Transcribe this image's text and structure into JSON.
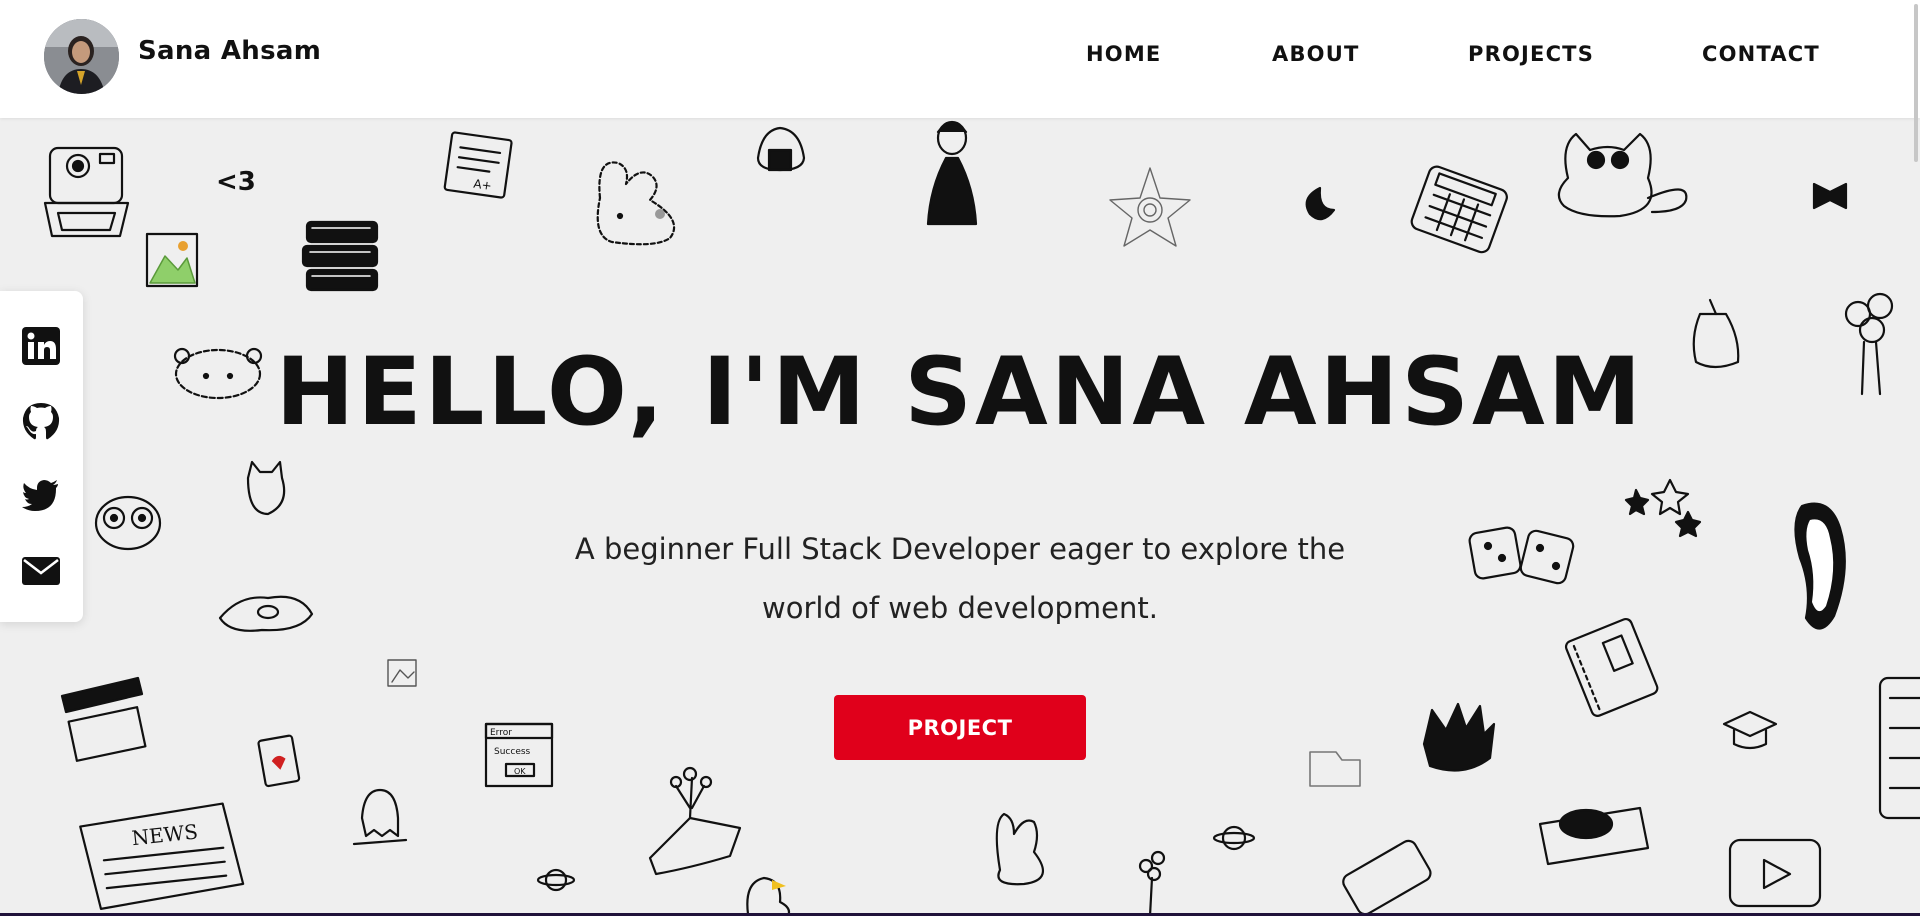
{
  "header": {
    "brand_name": "Sana Ahsam",
    "avatar_alt": "profile photo",
    "nav": [
      {
        "label": "HOME"
      },
      {
        "label": "ABOUT"
      },
      {
        "label": "PROJECTS"
      },
      {
        "label": "CONTACT"
      }
    ]
  },
  "hero": {
    "headline": "HELLO, I'M SANA AHSAM",
    "tagline": "A beginner Full Stack Developer eager to explore the world of web development.",
    "cta_label": "PROJECT",
    "doodle_texts": {
      "heart": "<3",
      "error_title": "Error",
      "error_msg": "Success",
      "error_ok": "OK",
      "news": "NEWS",
      "grade": "A+"
    }
  },
  "social": [
    {
      "name": "linkedin",
      "icon": "linkedin-icon"
    },
    {
      "name": "github",
      "icon": "github-icon"
    },
    {
      "name": "twitter",
      "icon": "twitter-icon"
    },
    {
      "name": "email",
      "icon": "email-icon"
    }
  ],
  "colors": {
    "accent": "#e0001b",
    "hero_bg": "#efefef",
    "header_bg": "#ffffff",
    "text": "#111111"
  }
}
